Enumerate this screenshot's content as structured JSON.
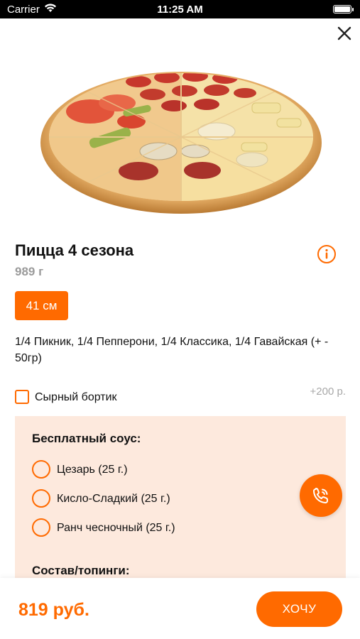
{
  "status_bar": {
    "carrier": "Carrier",
    "time": "11:25 AM"
  },
  "icons": {
    "close": "close-icon",
    "info": "info-icon",
    "phone": "phone-icon",
    "wifi": "wifi-icon",
    "battery": "battery-icon"
  },
  "product": {
    "title": "Пицца 4 сезона",
    "weight": "989 г",
    "size_label": "41 см",
    "description": "1/4 Пикник, 1/4 Пепперони, 1/4 Классика, 1/4 Гавайская (+ - 50гр)"
  },
  "crust_option": {
    "label": "Сырный бортик",
    "price": "+200 р.",
    "checked": false
  },
  "sauce": {
    "title": "Бесплатный соус:",
    "options": [
      {
        "label": "Цезарь (25 г.)"
      },
      {
        "label": "Кисло-Сладкий (25 г.)"
      },
      {
        "label": "Ранч чесночный (25 г.)"
      }
    ]
  },
  "toppings": {
    "title": "Состав/топинги:"
  },
  "footer": {
    "total": "819 руб.",
    "order_label": "ХОЧУ"
  },
  "colors": {
    "accent": "#ff6a00",
    "panel_bg": "#fde9dd",
    "muted_text": "#9a9a9a"
  }
}
